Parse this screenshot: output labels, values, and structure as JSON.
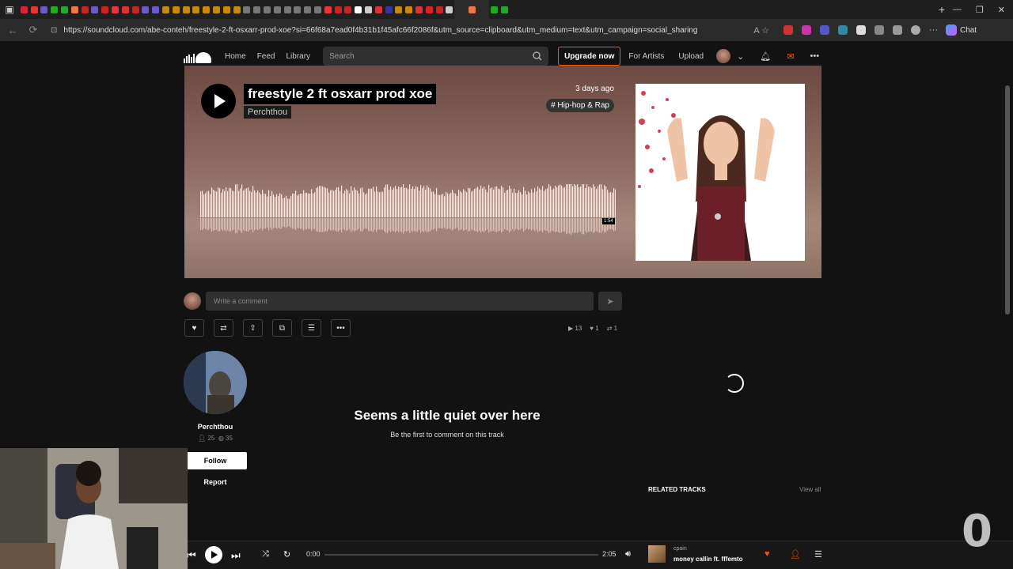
{
  "browser": {
    "url": "https://soundcloud.com/abe-conteh/freestyle-2-ft-osxarr-prod-xoe?si=66f68a7ead0f4b31b1f45afc66f2086f&utm_source=clipboard&utm_medium=text&utm_campaign=social_sharing",
    "chat_label": "Chat",
    "tab_colors": [
      "#d23",
      "#e33",
      "#6a5acd",
      "#2a2",
      "#2a2",
      "#e74",
      "#c22",
      "#6a5acd",
      "#c22",
      "#e33",
      "#d33",
      "#c22",
      "#6a5acd",
      "#6a5acd",
      "#c80",
      "#c80",
      "#c80",
      "#c80",
      "#c80",
      "#c80",
      "#c80",
      "#c80",
      "#777",
      "#777",
      "#777",
      "#777",
      "#777",
      "#777",
      "#777",
      "#777",
      "#e33",
      "#c22",
      "#c22",
      "#fff",
      "#ccc",
      "#d33",
      "#33a",
      "#c80",
      "#c80",
      "#d33",
      "#d22",
      "#c22",
      "#ccc",
      "#e74",
      "#2a2",
      "#2a2"
    ]
  },
  "header": {
    "nav": [
      "Home",
      "Feed",
      "Library"
    ],
    "search_placeholder": "Search",
    "upgrade": "Upgrade now",
    "for_artists": "For Artists",
    "upload": "Upload"
  },
  "track": {
    "title": "freestyle 2 ft osxarr prod xoe",
    "artist": "Perchthou",
    "posted": "3 days ago",
    "genre": "# Hip-hop & Rap",
    "duration_badge": "1:54"
  },
  "comment": {
    "placeholder": "Write a comment"
  },
  "stats": {
    "plays": "13",
    "likes": "1",
    "reposts": "1"
  },
  "artist_panel": {
    "name": "Perchthou",
    "followers": "25",
    "tracks": "35",
    "follow": "Follow",
    "report": "Report"
  },
  "empty_comments": {
    "title": "Seems a little quiet over here",
    "subtitle": "Be the first to comment on this track"
  },
  "related": {
    "title": "RELATED TRACKS",
    "view_all": "View all"
  },
  "player": {
    "current_time": "0:00",
    "total_time": "2:05",
    "artist": "cpain",
    "track": "money callin ft. fffemto"
  },
  "colors": {
    "accent": "#ff5500",
    "background": "#121212"
  }
}
